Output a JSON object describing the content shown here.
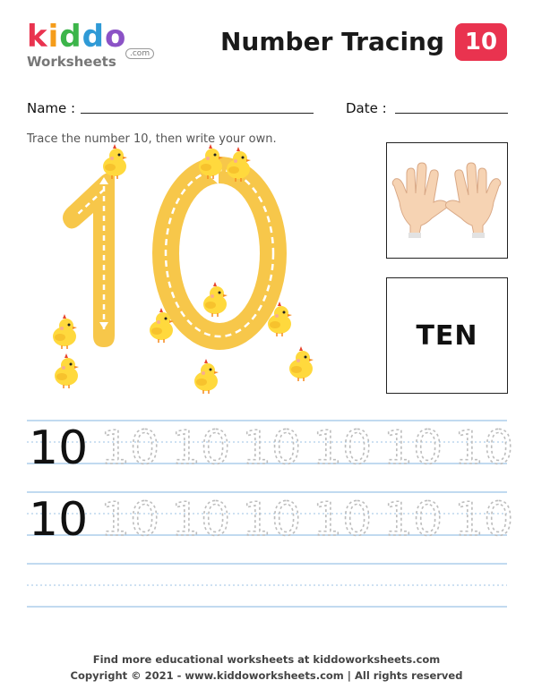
{
  "header": {
    "logo_main": "kiddo",
    "logo_sub": "Worksheets",
    "logo_com": ".com",
    "title": "Number Tracing",
    "badge": "10"
  },
  "fields": {
    "name_label": "Name :",
    "date_label": "Date :"
  },
  "instruction": "Trace the number 10, then write your own.",
  "big_number": "10",
  "number_word": "TEN",
  "practice": {
    "model": "10",
    "trace": "10",
    "rows": 2,
    "trace_count": 6
  },
  "footer": {
    "line1": "Find more educational worksheets at kiddoworksheets.com",
    "line2": "Copyright © 2021 - www.kiddoworksheets.com  |  All rights reserved"
  },
  "colors": {
    "badge": "#e9334f",
    "number_fill": "#f7c74a",
    "guide_line": "#9cc3e6",
    "trace_gray": "#bdbdbd",
    "chick_yellow": "#ffd93d"
  },
  "icons": [
    "chick-icon",
    "hands-icon"
  ]
}
